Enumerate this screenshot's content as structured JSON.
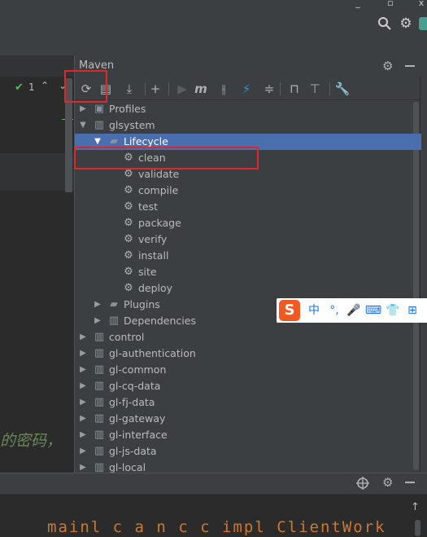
{
  "window": {
    "close_glyph": "x",
    "nav_icons": [
      "search-icon",
      "gear-icon"
    ]
  },
  "editor": {
    "check_count": "1",
    "comment_text": "的密码，",
    "code_line": "mainl c a n c c impl ClientWork"
  },
  "maven": {
    "title": "Maven",
    "toolbar": [
      {
        "name": "reload-icon",
        "glyph": "⟳"
      },
      {
        "name": "generate-sources-icon",
        "glyph": "▤"
      },
      {
        "name": "download-icon",
        "glyph": "⤓"
      },
      {
        "name": "add-icon",
        "glyph": "+"
      },
      {
        "name": "run-icon",
        "glyph": "▶"
      },
      {
        "name": "execute-goal-icon",
        "glyph": "m"
      },
      {
        "name": "toggle-offline-icon",
        "glyph": "⫲"
      },
      {
        "name": "skip-tests-icon",
        "glyph": "⚡"
      },
      {
        "name": "collapse-all-icon",
        "glyph": "≑"
      },
      {
        "name": "show-dependencies-icon",
        "glyph": "⊓"
      },
      {
        "name": "expand-all-icon",
        "glyph": "⊤"
      },
      {
        "name": "settings-wrench-icon",
        "glyph": "🔧"
      }
    ],
    "tree": [
      {
        "label": "Profiles",
        "level": 1,
        "arrow": "collapsed",
        "icon": "profiles-icon"
      },
      {
        "label": "glsystem",
        "level": 1,
        "arrow": "expanded",
        "icon": "maven-module-icon"
      },
      {
        "label": "Lifecycle",
        "level": 2,
        "arrow": "expanded",
        "icon": "folder-icon",
        "selected": true
      },
      {
        "label": "clean",
        "level": 3,
        "icon": "gear-icon"
      },
      {
        "label": "validate",
        "level": 3,
        "icon": "gear-icon"
      },
      {
        "label": "compile",
        "level": 3,
        "icon": "gear-icon"
      },
      {
        "label": "test",
        "level": 3,
        "icon": "gear-icon"
      },
      {
        "label": "package",
        "level": 3,
        "icon": "gear-icon"
      },
      {
        "label": "verify",
        "level": 3,
        "icon": "gear-icon"
      },
      {
        "label": "install",
        "level": 3,
        "icon": "gear-icon"
      },
      {
        "label": "site",
        "level": 3,
        "icon": "gear-icon"
      },
      {
        "label": "deploy",
        "level": 3,
        "icon": "gear-icon"
      },
      {
        "label": "Plugins",
        "level": 2,
        "arrow": "collapsed",
        "icon": "folder-icon"
      },
      {
        "label": "Dependencies",
        "level": 2,
        "arrow": "collapsed",
        "icon": "dependencies-icon"
      },
      {
        "label": "control",
        "level": 1,
        "arrow": "collapsed",
        "icon": "maven-module-icon"
      },
      {
        "label": "gl-authentication",
        "level": 1,
        "arrow": "collapsed",
        "icon": "maven-module-icon"
      },
      {
        "label": "gl-common",
        "level": 1,
        "arrow": "collapsed",
        "icon": "maven-module-icon"
      },
      {
        "label": "gl-cq-data",
        "level": 1,
        "arrow": "collapsed",
        "icon": "maven-module-icon"
      },
      {
        "label": "gl-fj-data",
        "level": 1,
        "arrow": "collapsed",
        "icon": "maven-module-icon"
      },
      {
        "label": "gl-gateway",
        "level": 1,
        "arrow": "collapsed",
        "icon": "maven-module-icon"
      },
      {
        "label": "gl-interface",
        "level": 1,
        "arrow": "collapsed",
        "icon": "maven-module-icon"
      },
      {
        "label": "gl-js-data",
        "level": 1,
        "arrow": "collapsed",
        "icon": "maven-module-icon"
      },
      {
        "label": "gl-local",
        "level": 1,
        "arrow": "collapsed",
        "icon": "maven-module-icon"
      }
    ]
  },
  "ime": {
    "logo": "S",
    "items": [
      "中",
      "°,",
      "🎤",
      "⌨",
      "👕",
      "⊞"
    ]
  },
  "colors": {
    "selection": "#4b6eaf",
    "annotation_red": "#e0262d",
    "ime_orange": "#f05a22"
  }
}
